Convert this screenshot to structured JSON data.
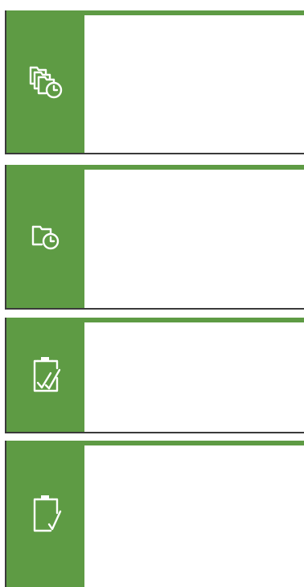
{
  "colors": {
    "accent": "#5e9b44",
    "tile_border": "#3a3a3a",
    "tile_body": "#ffffff",
    "icon": "#ffffff"
  },
  "tiles": [
    {
      "icon": "stacked-folders-clock-icon"
    },
    {
      "icon": "folder-clock-icon"
    },
    {
      "icon": "clipboard-double-check-icon"
    },
    {
      "icon": "clipboard-check-icon"
    }
  ]
}
